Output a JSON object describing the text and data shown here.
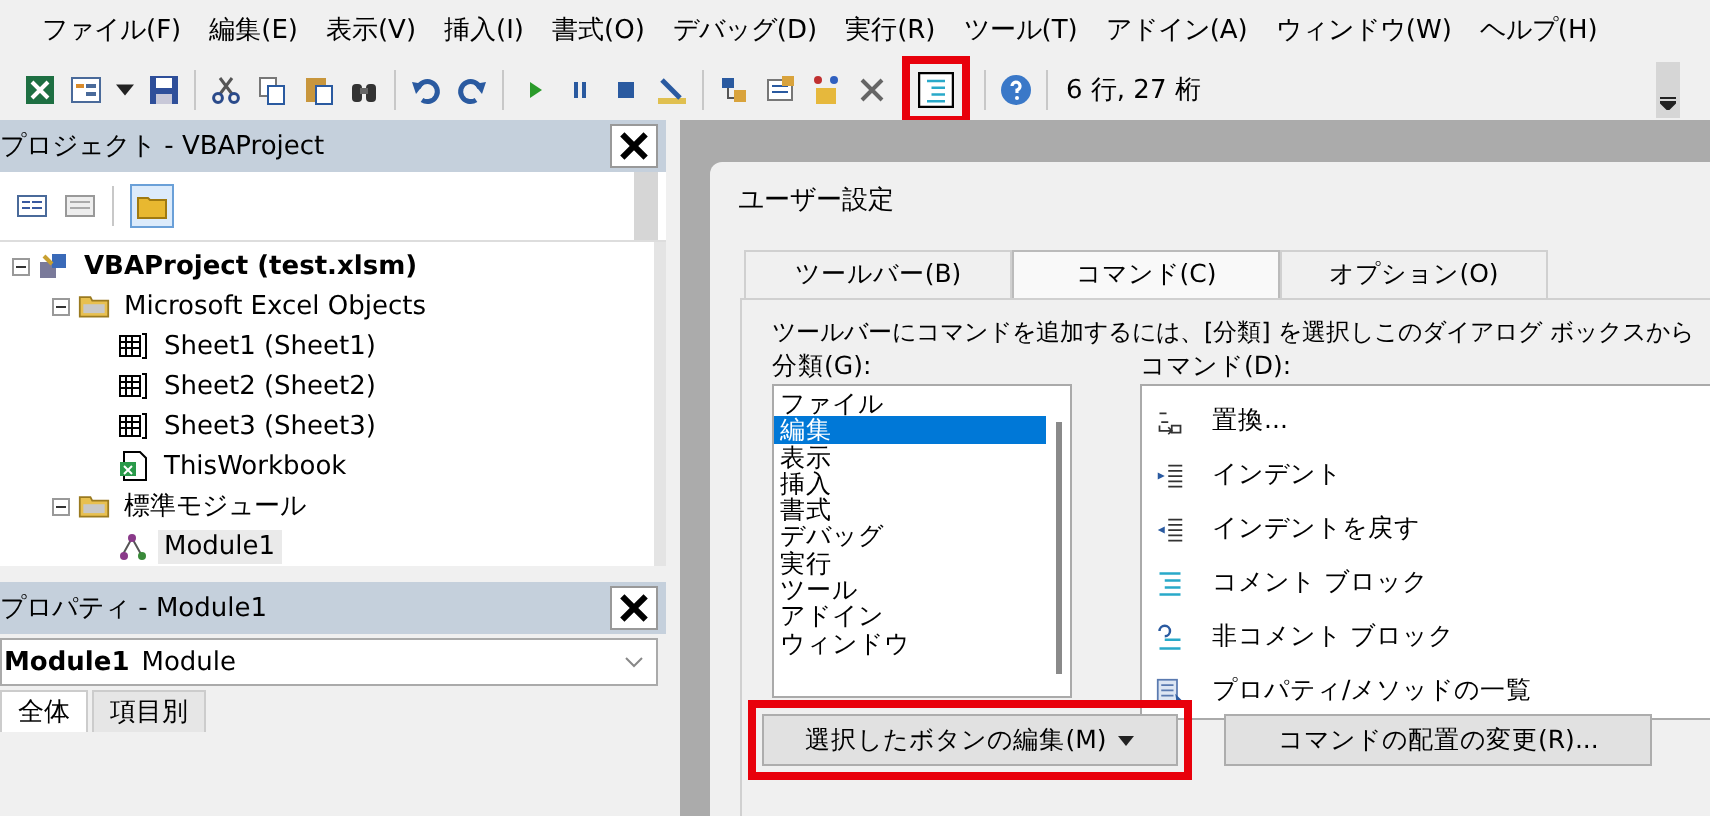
{
  "menu": [
    "ファイル(F)",
    "編集(E)",
    "表示(V)",
    "挿入(I)",
    "書式(O)",
    "デバッグ(D)",
    "実行(R)",
    "ツール(T)",
    "アドイン(A)",
    "ウィンドウ(W)",
    "ヘルプ(H)"
  ],
  "toolbar": {
    "comment_block_highlighted": true,
    "position": "6 行, 27 桁"
  },
  "project": {
    "title": "プロジェクト - VBAProject",
    "tree": [
      {
        "label": "VBAProject (test.xlsm)",
        "kind": "project",
        "bold": true,
        "expanded": true,
        "selected": false,
        "children": [
          {
            "label": "Microsoft Excel Objects",
            "kind": "folder",
            "bold": false,
            "expanded": true,
            "selected": false,
            "children": [
              {
                "label": "Sheet1 (Sheet1)",
                "kind": "sheet",
                "bold": false,
                "selected": false
              },
              {
                "label": "Sheet2 (Sheet2)",
                "kind": "sheet",
                "bold": false,
                "selected": false
              },
              {
                "label": "Sheet3 (Sheet3)",
                "kind": "sheet",
                "bold": false,
                "selected": false
              },
              {
                "label": "ThisWorkbook",
                "kind": "workbook",
                "bold": false,
                "selected": false
              }
            ]
          },
          {
            "label": "標準モジュール",
            "kind": "folder",
            "bold": false,
            "expanded": true,
            "selected": false,
            "children": [
              {
                "label": "Module1",
                "kind": "module",
                "bold": false,
                "selected": true
              }
            ]
          }
        ]
      }
    ]
  },
  "properties": {
    "title": "プロパティ - Module1",
    "object_name": "Module1",
    "object_type": "Module",
    "tabs": [
      {
        "label": "全体",
        "selected": true
      },
      {
        "label": "項目別",
        "selected": false
      }
    ]
  },
  "dialog": {
    "title": "ユーザー設定",
    "tabs": [
      {
        "label": "ツールバー(B)",
        "selected": false
      },
      {
        "label": "コマンド(C)",
        "selected": true
      },
      {
        "label": "オプション(O)",
        "selected": false
      }
    ],
    "description": "ツールバーにコマンドを追加するには、[分類] を選択しこのダイアログ ボックスから",
    "categories_label": "分類(G):",
    "categories": [
      {
        "label": "ファイル",
        "selected": false
      },
      {
        "label": "編集",
        "selected": true
      },
      {
        "label": "表示",
        "selected": false
      },
      {
        "label": "挿入",
        "selected": false
      },
      {
        "label": "書式",
        "selected": false
      },
      {
        "label": "デバッグ",
        "selected": false
      },
      {
        "label": "実行",
        "selected": false
      },
      {
        "label": "ツール",
        "selected": false
      },
      {
        "label": "アドイン",
        "selected": false
      },
      {
        "label": "ウィンドウ",
        "selected": false
      }
    ],
    "commands_label": "コマンド(D):",
    "commands": [
      {
        "label": "置換...",
        "kind": "replace"
      },
      {
        "label": "インデント",
        "kind": "indent"
      },
      {
        "label": "インデントを戻す",
        "kind": "outdent"
      },
      {
        "label": "コメント ブロック",
        "kind": "comment"
      },
      {
        "label": "非コメント ブロック",
        "kind": "uncomment"
      },
      {
        "label": "プロパティ/メソッドの一覧",
        "kind": "list"
      }
    ],
    "buttons": [
      {
        "label": "選択したボタンの編集(M)",
        "has_menu": true,
        "highlighted": true
      },
      {
        "label": "コマンドの配置の変更(R)...",
        "has_menu": false,
        "highlighted": false
      }
    ]
  }
}
